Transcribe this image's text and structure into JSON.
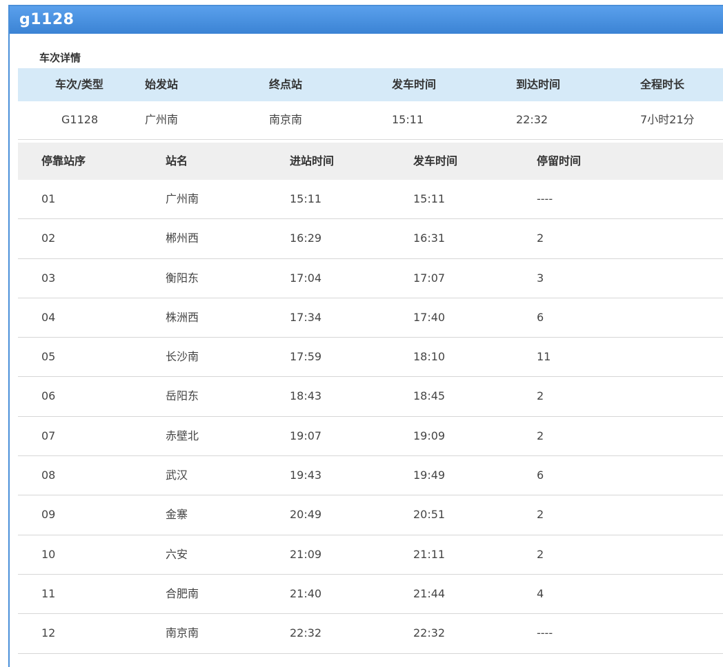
{
  "window": {
    "title": "g1128"
  },
  "section": {
    "title": "车次详情"
  },
  "summary": {
    "headers": [
      "车次/类型",
      "始发站",
      "终点站",
      "发车时间",
      "到达时间",
      "全程时长"
    ],
    "values": [
      "G1128",
      "广州南",
      "南京南",
      "15:11",
      "22:32",
      "7小时21分"
    ]
  },
  "stops": {
    "headers": [
      "停靠站序",
      "站名",
      "进站时间",
      "发车时间",
      "停留时间"
    ],
    "rows": [
      [
        "01",
        "广州南",
        "15:11",
        "15:11",
        "----"
      ],
      [
        "02",
        "郴州西",
        "16:29",
        "16:31",
        "2"
      ],
      [
        "03",
        "衡阳东",
        "17:04",
        "17:07",
        "3"
      ],
      [
        "04",
        "株洲西",
        "17:34",
        "17:40",
        "6"
      ],
      [
        "05",
        "长沙南",
        "17:59",
        "18:10",
        "11"
      ],
      [
        "06",
        "岳阳东",
        "18:43",
        "18:45",
        "2"
      ],
      [
        "07",
        "赤壁北",
        "19:07",
        "19:09",
        "2"
      ],
      [
        "08",
        "武汉",
        "19:43",
        "19:49",
        "6"
      ],
      [
        "09",
        "金寨",
        "20:49",
        "20:51",
        "2"
      ],
      [
        "10",
        "六安",
        "21:09",
        "21:11",
        "2"
      ],
      [
        "11",
        "合肥南",
        "21:40",
        "21:44",
        "4"
      ],
      [
        "12",
        "南京南",
        "22:32",
        "22:32",
        "----"
      ]
    ]
  },
  "colors": {
    "titlebar": "#4a8fd9",
    "summary_header": "#d6eaf8",
    "stops_header": "#efefef"
  }
}
